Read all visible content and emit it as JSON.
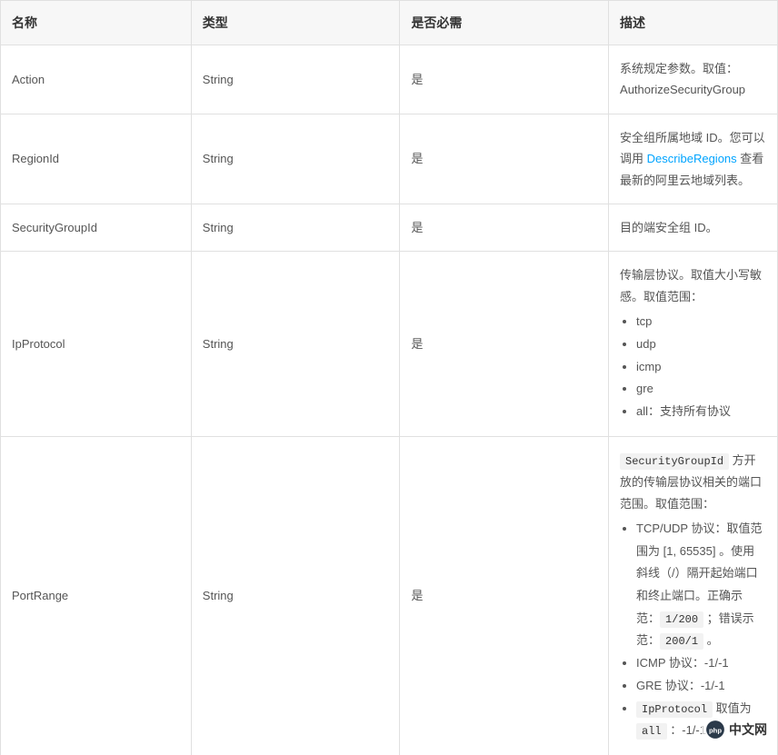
{
  "headers": {
    "name": "名称",
    "type": "类型",
    "required": "是否必需",
    "description": "描述"
  },
  "rows": [
    {
      "name": "Action",
      "type": "String",
      "required": "是",
      "desc": {
        "text": "系统规定参数。取值：AuthorizeSecurityGroup"
      }
    },
    {
      "name": "RegionId",
      "type": "String",
      "required": "是",
      "desc": {
        "before_link": "安全组所属地域 ID。您可以调用 ",
        "link_text": "DescribeRegions",
        "after_link": " 查看最新的阿里云地域列表。"
      }
    },
    {
      "name": "SecurityGroupId",
      "type": "String",
      "required": "是",
      "desc": {
        "text": "目的端安全组 ID。"
      }
    },
    {
      "name": "IpProtocol",
      "type": "String",
      "required": "是",
      "desc": {
        "intro": "传输层协议。取值大小写敏感。取值范围：",
        "items": [
          "tcp",
          "udp",
          "icmp",
          "gre",
          "all：支持所有协议"
        ]
      }
    },
    {
      "name": "PortRange",
      "type": "String",
      "required": "是",
      "desc": {
        "code1": "SecurityGroupId",
        "after_code1": " 方开放的传输层协议相关的端口范围。取值范围：",
        "li1_a": "TCP/UDP 协议：取值范围为 [1, 65535] 。使用斜线（/）隔开起始端口和终止端口。正确示范：",
        "li1_code1": "1/200",
        "li1_b": " ；错误示范：",
        "li1_code2": "200/1",
        "li1_c": " 。",
        "li2": "ICMP 协议：-1/-1",
        "li3": "GRE 协议：-1/-1",
        "li4_code": "IpProtocol",
        "li4_mid": " 取值为 ",
        "li4_code2": "all",
        "li4_tail": " ：-1/-1"
      }
    }
  ],
  "watermark": {
    "text": "中文网",
    "prefix": "php"
  }
}
